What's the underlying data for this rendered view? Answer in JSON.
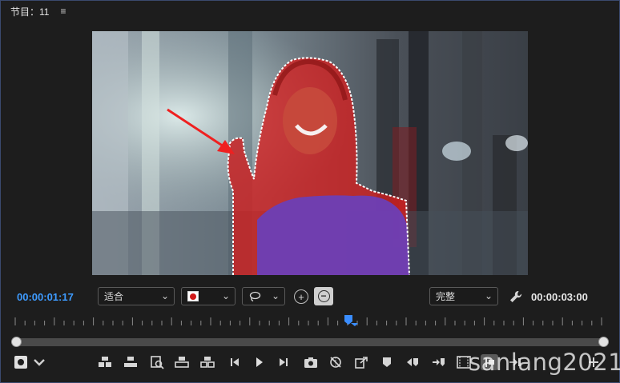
{
  "header": {
    "title": "节目：11",
    "menu_icon": "hamburger-menu-icon"
  },
  "controls": {
    "current_timecode": "00:00:01:17",
    "fit_value": "适合",
    "lasso_icon": "lasso-icon",
    "quality_value": "完整",
    "duration_timecode": "00:00:03:00",
    "chevron": "⌄",
    "add_glyph": "+",
    "subtract_glyph": "−",
    "overlay_color": "#d11919"
  },
  "playhead": {
    "position_fraction": 0.573
  },
  "watermark": "sanlang2021"
}
